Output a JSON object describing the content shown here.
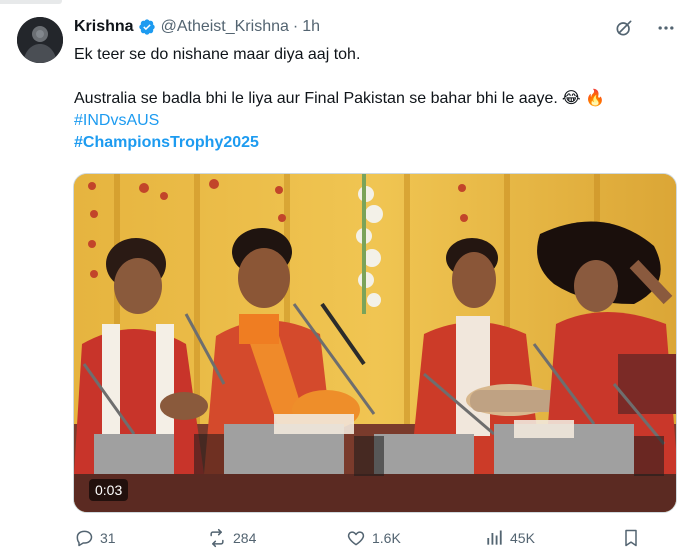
{
  "author": {
    "display_name": "Krishna",
    "handle": "@Atheist_Krishna",
    "separator": "·",
    "time": "1h",
    "verified": true
  },
  "post": {
    "line1": "Ek teer se do nishane maar diya aaj toh.",
    "line2": "Australia se badla bhi le liya aur Final Pakistan se bahar bhi le aaye.",
    "line2_emojis": "😂 🔥",
    "hashtags": [
      "#INDvsAUS",
      "#ChampionsTrophy2025"
    ]
  },
  "media": {
    "type": "video",
    "timestamp": "0:03"
  },
  "actions": {
    "replies": "31",
    "reposts": "284",
    "likes": "1.6K",
    "views": "45K"
  },
  "icons": {
    "verified": "verified-badge-icon",
    "grok": "grok-icon",
    "more": "more-icon",
    "reply": "reply-icon",
    "repost": "repost-icon",
    "like": "heart-icon",
    "views": "views-icon",
    "bookmark": "bookmark-icon"
  },
  "colors": {
    "accent": "#1d9bf0",
    "text": "#0f1419",
    "secondary": "#536471"
  }
}
